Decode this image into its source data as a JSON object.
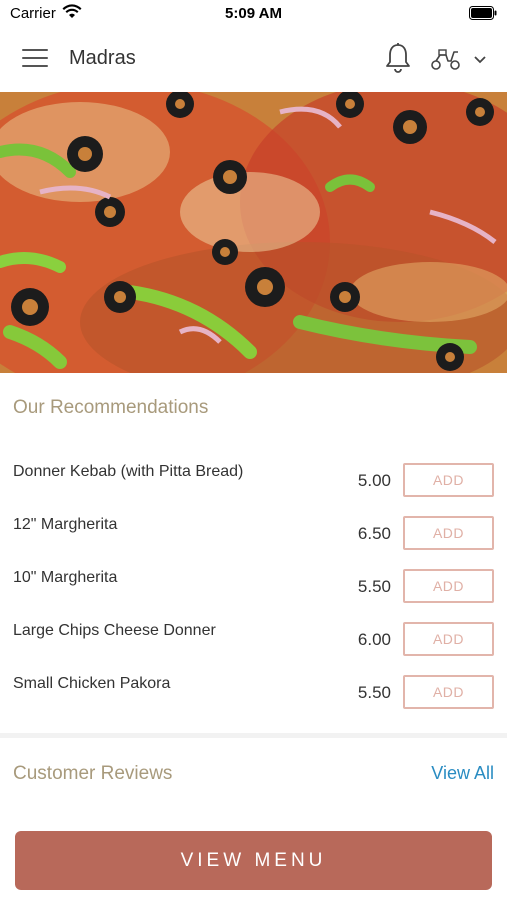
{
  "status_bar": {
    "carrier": "Carrier",
    "time": "5:09 AM"
  },
  "nav": {
    "title": "Madras",
    "icons": [
      "menu-icon",
      "bell-icon",
      "scooter-icon",
      "chevron-down-icon"
    ]
  },
  "hero": {
    "image": "pizza-photo"
  },
  "recommendations": {
    "title": "Our Recommendations",
    "items": [
      {
        "name": "Donner Kebab (with Pitta Bread)",
        "price": "5.00",
        "action": "ADD"
      },
      {
        "name": "12\" Margherita",
        "price": "6.50",
        "action": "ADD"
      },
      {
        "name": "10\" Margherita",
        "price": "5.50",
        "action": "ADD"
      },
      {
        "name": "Large Chips Cheese Donner",
        "price": "6.00",
        "action": "ADD"
      },
      {
        "name": "Small Chicken Pakora",
        "price": "5.50",
        "action": "ADD"
      }
    ]
  },
  "reviews": {
    "title": "Customer Reviews",
    "view_all": "View All"
  },
  "footer": {
    "button": "VIEW MENU"
  },
  "colors": {
    "accent": "#b8695a",
    "section_title": "#a89a7c",
    "link": "#2a8cc2",
    "add_border": "#e2b5ab"
  }
}
